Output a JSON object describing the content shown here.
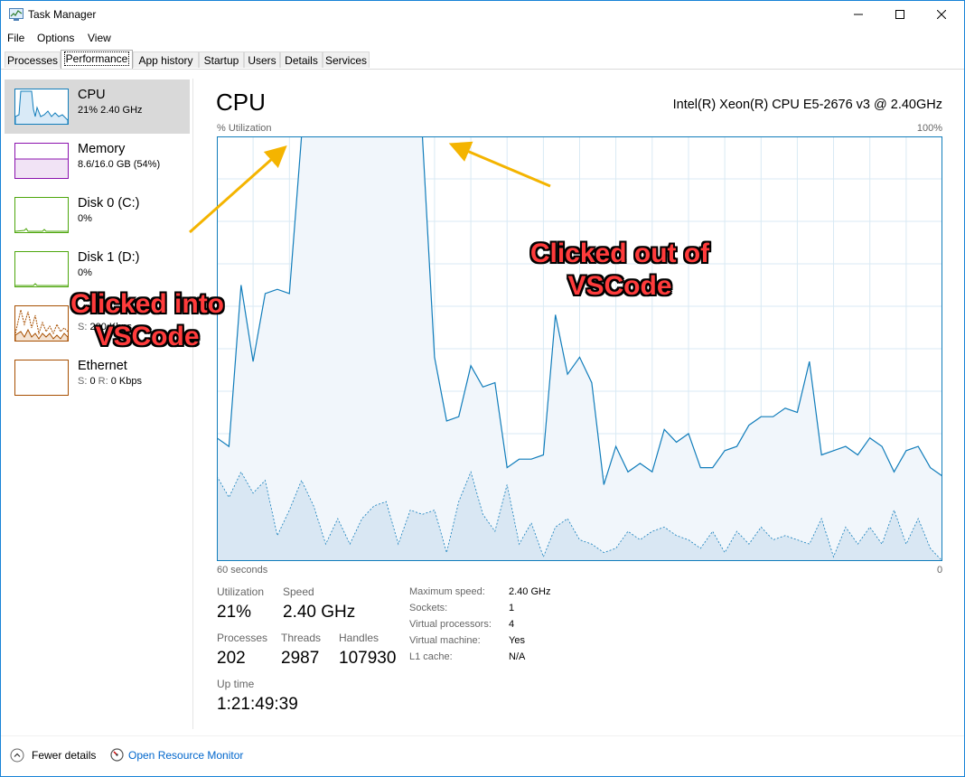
{
  "window": {
    "title": "Task Manager"
  },
  "menu": [
    "File",
    "Options",
    "View"
  ],
  "tabs": [
    "Processes",
    "Performance",
    "App history",
    "Startup",
    "Users",
    "Details",
    "Services"
  ],
  "active_tab": "Performance",
  "sidebar": {
    "items": [
      {
        "name": "CPU",
        "sub": "21% 2.40 GHz",
        "color": "#117dbb",
        "selected": true
      },
      {
        "name": "Memory",
        "sub": "8.6/16.0 GB (54%)",
        "color": "#8b12ae"
      },
      {
        "name": "Disk 0 (C:)",
        "sub": "0%",
        "color": "#4da60c"
      },
      {
        "name": "Disk 1 (D:)",
        "sub": "0%",
        "color": "#4da60c"
      },
      {
        "name": "",
        "sub_lbl": "S:",
        "sub": "200 Kbps",
        "color": "#a74f01"
      },
      {
        "name": "Ethernet",
        "sub_s_lbl": "S:",
        "sub_s": "0",
        "sub_r_lbl": "R:",
        "sub_r": "0 Kbps",
        "color": "#a74f01"
      }
    ]
  },
  "main": {
    "title": "CPU",
    "model": "Intel(R) Xeon(R) CPU E5-2676 v3 @ 2.40GHz",
    "y_label": "% Utilization",
    "y_max_label": "100%",
    "x_left_label": "60 seconds",
    "x_right_label": "0",
    "stats": {
      "utilization_label": "Utilization",
      "utilization": "21%",
      "speed_label": "Speed",
      "speed": "2.40 GHz",
      "processes_label": "Processes",
      "processes": "202",
      "threads_label": "Threads",
      "threads": "2987",
      "handles_label": "Handles",
      "handles": "107930",
      "uptime_label": "Up time",
      "uptime": "1:21:49:39"
    },
    "details": [
      {
        "label": "Maximum speed:",
        "value": "2.40 GHz"
      },
      {
        "label": "Sockets:",
        "value": "1"
      },
      {
        "label": "Virtual processors:",
        "value": "4"
      },
      {
        "label": "Virtual machine:",
        "value": "Yes"
      },
      {
        "label": "L1 cache:",
        "value": "N/A"
      }
    ]
  },
  "footer": {
    "fewer_details": "Fewer details",
    "open_resmon": "Open Resource Monitor"
  },
  "annotations": {
    "clicked_into_line1": "Clicked into",
    "clicked_into_line2": "VSCode",
    "clicked_out_line1": "Clicked out of",
    "clicked_out_line2": "VSCode"
  },
  "chart_data": {
    "type": "area",
    "title": "",
    "ylabel": "% Utilization",
    "ylim": [
      0,
      100
    ],
    "xlim": [
      60,
      0
    ],
    "series": [
      {
        "name": "",
        "values": [
          29,
          27,
          65,
          47,
          63,
          64,
          63,
          100,
          100,
          100,
          100,
          100,
          100,
          100,
          100,
          100,
          100,
          100,
          48,
          33,
          34,
          46,
          41,
          42,
          22,
          24,
          24,
          25,
          58,
          44,
          48,
          42,
          18,
          27,
          21,
          23,
          21,
          31,
          28,
          30,
          22,
          22,
          26,
          27,
          32,
          34,
          34,
          36,
          35,
          47,
          25,
          26,
          27,
          25,
          29,
          27,
          21,
          26,
          27,
          22,
          20
        ]
      },
      {
        "name": "",
        "values": [
          20,
          15,
          21,
          16,
          19,
          6,
          12,
          19,
          13,
          4,
          10,
          4,
          10,
          13,
          14,
          4,
          12,
          11,
          12,
          2,
          14,
          21,
          11,
          7,
          18,
          4,
          9,
          1,
          8,
          10,
          5,
          4,
          2,
          3,
          7,
          5,
          7,
          8,
          6,
          5,
          3,
          7,
          2,
          7,
          4,
          8,
          5,
          6,
          5,
          4,
          10,
          1,
          8,
          4,
          8,
          4,
          12,
          4,
          10,
          3,
          0
        ]
      }
    ]
  }
}
